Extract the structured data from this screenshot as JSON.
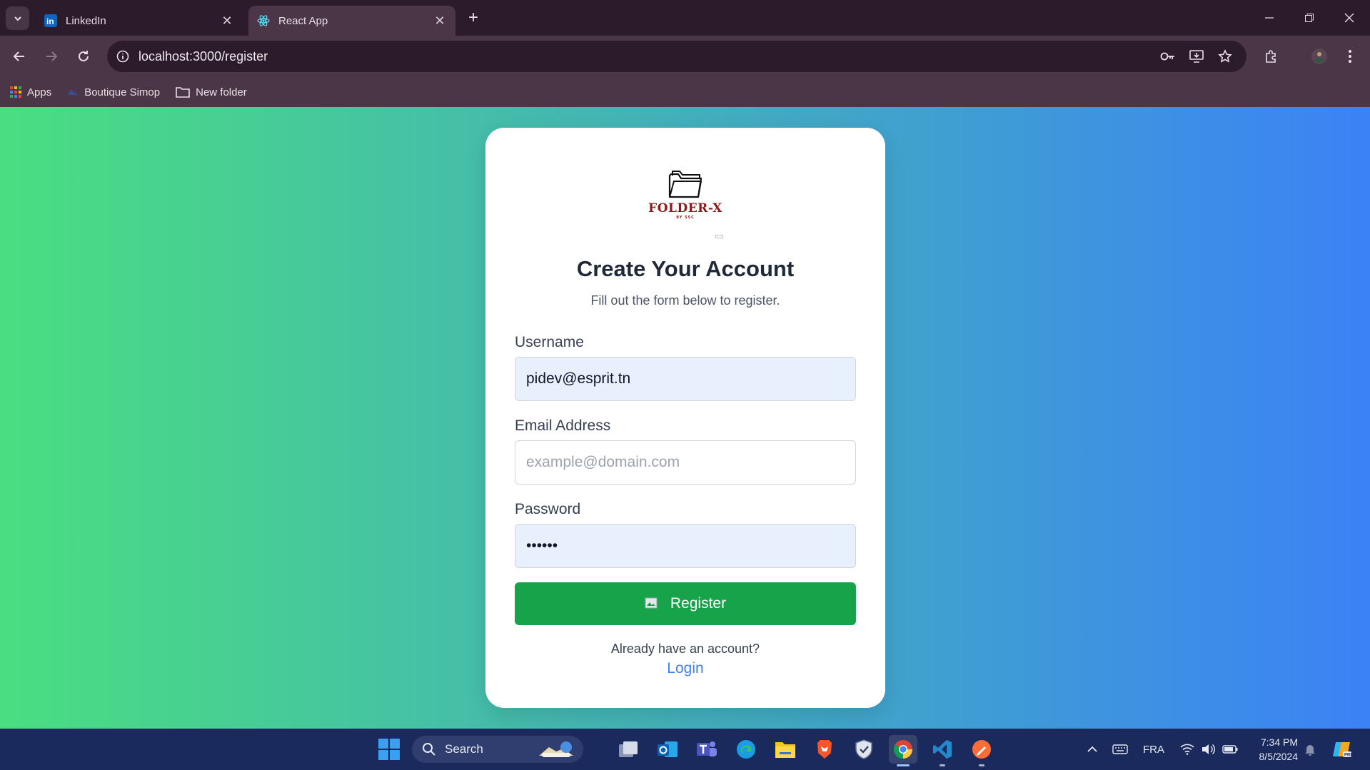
{
  "browser": {
    "tabs": [
      {
        "title": "LinkedIn",
        "active": false
      },
      {
        "title": "React App",
        "active": true
      }
    ],
    "url": "localhost:3000/register",
    "bookmarks": [
      {
        "label": "Apps"
      },
      {
        "label": "Boutique Simop"
      },
      {
        "label": "New folder"
      }
    ]
  },
  "register": {
    "logo_text": "FOLDER-X",
    "logo_sub": "BY SSC",
    "title": "Create Your Account",
    "subtitle": "Fill out the form below to register.",
    "username_label": "Username",
    "username_value": "pidev@esprit.tn",
    "email_label": "Email Address",
    "email_placeholder": "example@domain.com",
    "password_label": "Password",
    "password_value": "••••••",
    "register_label": "Register",
    "already_text": "Already have an account?",
    "login_label": "Login"
  },
  "taskbar": {
    "search_label": "Search",
    "language": "FRA",
    "time": "7:34 PM",
    "date": "8/5/2024"
  },
  "colors": {
    "gradient_start": "#4ade80",
    "gradient_end": "#3b82f6",
    "register_button": "#16a34a",
    "login_link": "#3b82f6"
  }
}
